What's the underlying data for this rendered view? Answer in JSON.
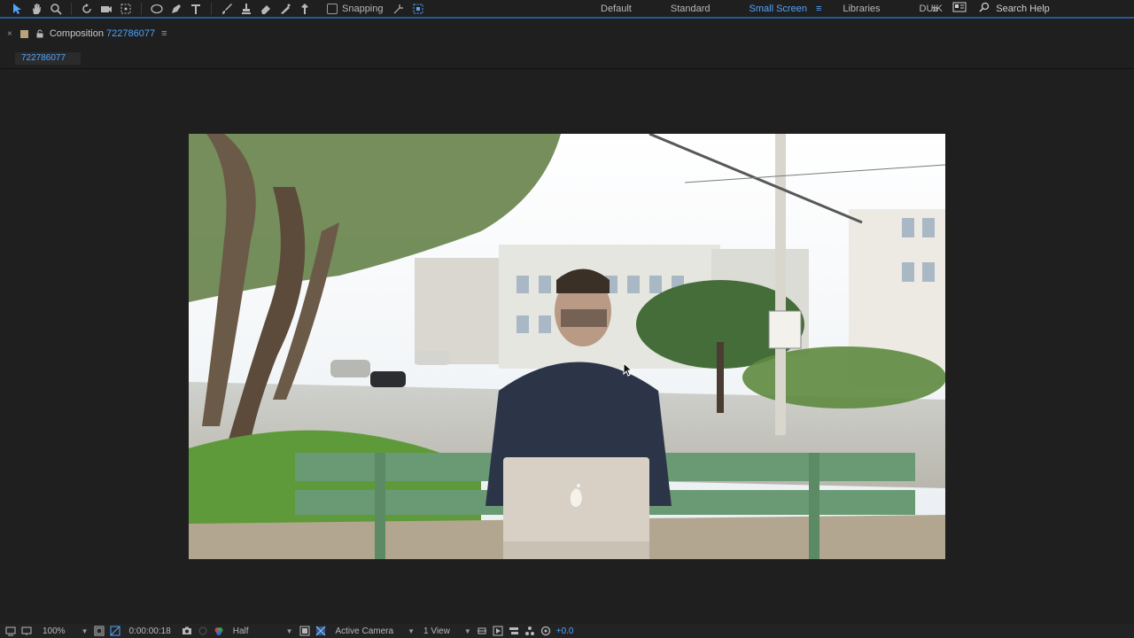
{
  "toolbar": {
    "snapping_label": "Snapping",
    "workspaces": [
      "Default",
      "Standard",
      "Small Screen",
      "Libraries",
      "DUIK"
    ],
    "active_workspace": "Small Screen",
    "search_label": "Search Help"
  },
  "panel": {
    "title_prefix": "Composition",
    "comp_name": "722786077"
  },
  "comp_tab": {
    "label": "722786077"
  },
  "footer": {
    "zoom": "100%",
    "timecode": "0:00:00:18",
    "resolution": "Half",
    "camera": "Active Camera",
    "views": "1 View",
    "exposure": "+0.0"
  },
  "colors": {
    "accent": "#4ea4ff",
    "background": "#1f1f1f"
  }
}
